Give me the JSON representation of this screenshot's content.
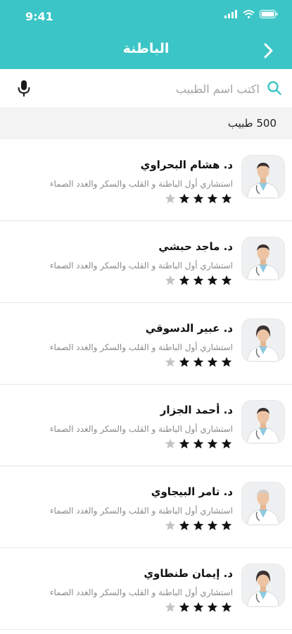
{
  "status_bar": {
    "time": "9:41"
  },
  "header": {
    "title": "الباطنة",
    "back_icon": "chevron-right-icon"
  },
  "search": {
    "placeholder": "اكتب اسم الطبيب",
    "value": "",
    "icon": "search-icon",
    "mic_icon": "microphone-icon"
  },
  "results": {
    "count_label": "500 طبيب"
  },
  "colors": {
    "primary": "#3cc5c6",
    "star_filled": "#111111",
    "star_empty": "#c4c4c4"
  },
  "doctors": [
    {
      "name": "د. هشام البحراوي",
      "title": "استشاري أول الباطنة و القلب والسكر والغدد الصماء",
      "rating": 4,
      "rating_max": 5
    },
    {
      "name": "د. ماجد حبشي",
      "title": "استشاري أول الباطنة و القلب والسكر والغدد الصماء",
      "rating": 4,
      "rating_max": 5
    },
    {
      "name": "د. عبير الدسوقي",
      "title": "استشاري أول الباطنة و القلب والسكر والغدد الصماء",
      "rating": 4,
      "rating_max": 5
    },
    {
      "name": "د. أحمد الجزار",
      "title": "استشاري أول الباطنة و القلب والسكر والغدد الصماء",
      "rating": 4,
      "rating_max": 5
    },
    {
      "name": "د. تامر البيجاوي",
      "title": "استشاري أول الباطنة و القلب والسكر والغدد الصماء",
      "rating": 4,
      "rating_max": 5
    },
    {
      "name": "د. إيمان طنطاوي",
      "title": "استشاري أول الباطنة و القلب والسكر والغدد الصماء",
      "rating": 4,
      "rating_max": 5
    }
  ]
}
